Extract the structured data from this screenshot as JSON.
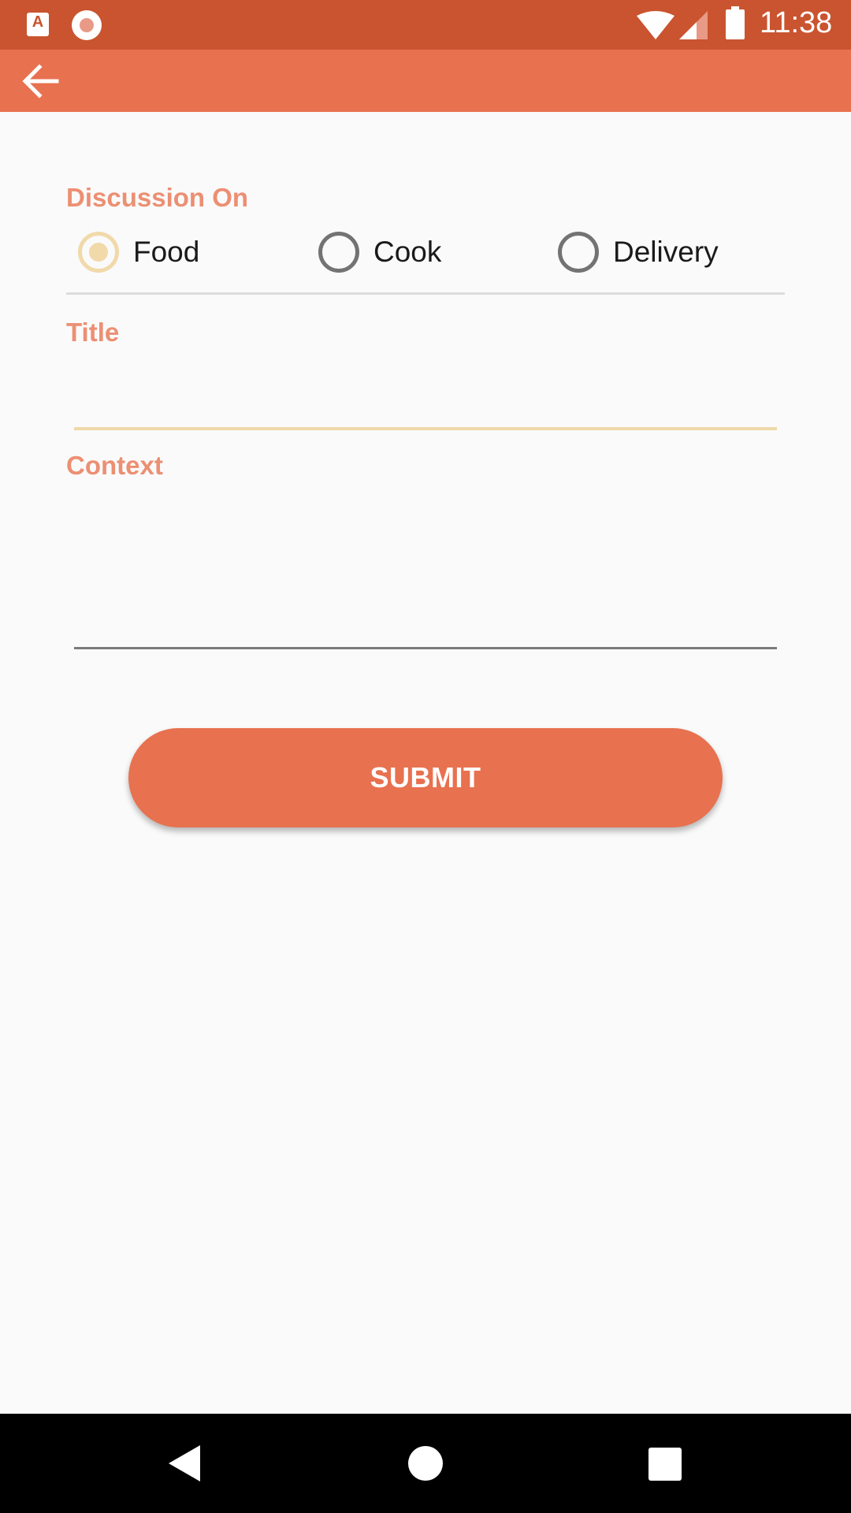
{
  "status_bar": {
    "time": "11:38",
    "icons": [
      "app-a-icon",
      "record-icon",
      "wifi-icon",
      "signal-icon",
      "battery-icon"
    ]
  },
  "toolbar": {
    "back_icon": "arrow-left-icon"
  },
  "form": {
    "discussion_label": "Discussion On",
    "options": [
      {
        "label": "Food",
        "selected": true
      },
      {
        "label": "Cook",
        "selected": false
      },
      {
        "label": "Delivery",
        "selected": false
      }
    ],
    "title_label": "Title",
    "title_value": "",
    "context_label": "Context",
    "context_value": "",
    "submit_label": "SUBMIT"
  },
  "colors": {
    "status_bar": "#c9542f",
    "accent": "#e8714f",
    "label": "#ec8f73",
    "radio_selected": "#f1d9aa"
  },
  "nav_bar": {
    "icons": [
      "nav-back-icon",
      "nav-home-icon",
      "nav-recents-icon"
    ]
  }
}
